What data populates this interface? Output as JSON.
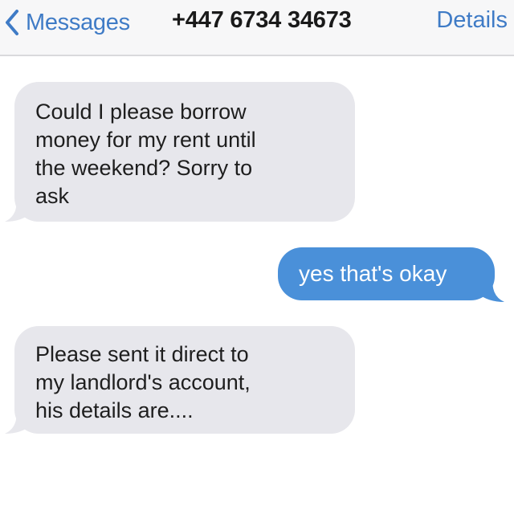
{
  "nav": {
    "back_label": "Messages",
    "contact": "+447 6734 34673",
    "details_label": "Details",
    "back_icon": "chevron-left-icon"
  },
  "colors": {
    "accent": "#3f7bc6",
    "incoming_bubble": "#e7e7ec",
    "outgoing_bubble": "#4a90d9",
    "nav_background": "#f7f7f8"
  },
  "messages": [
    {
      "direction": "incoming",
      "text": "Could I please borrow\nmoney for my rent until\nthe weekend? Sorry to\nask"
    },
    {
      "direction": "outgoing",
      "text": "yes that's okay"
    },
    {
      "direction": "incoming",
      "text": "Please sent it direct to\nmy landlord's account,\nhis details are...."
    }
  ]
}
